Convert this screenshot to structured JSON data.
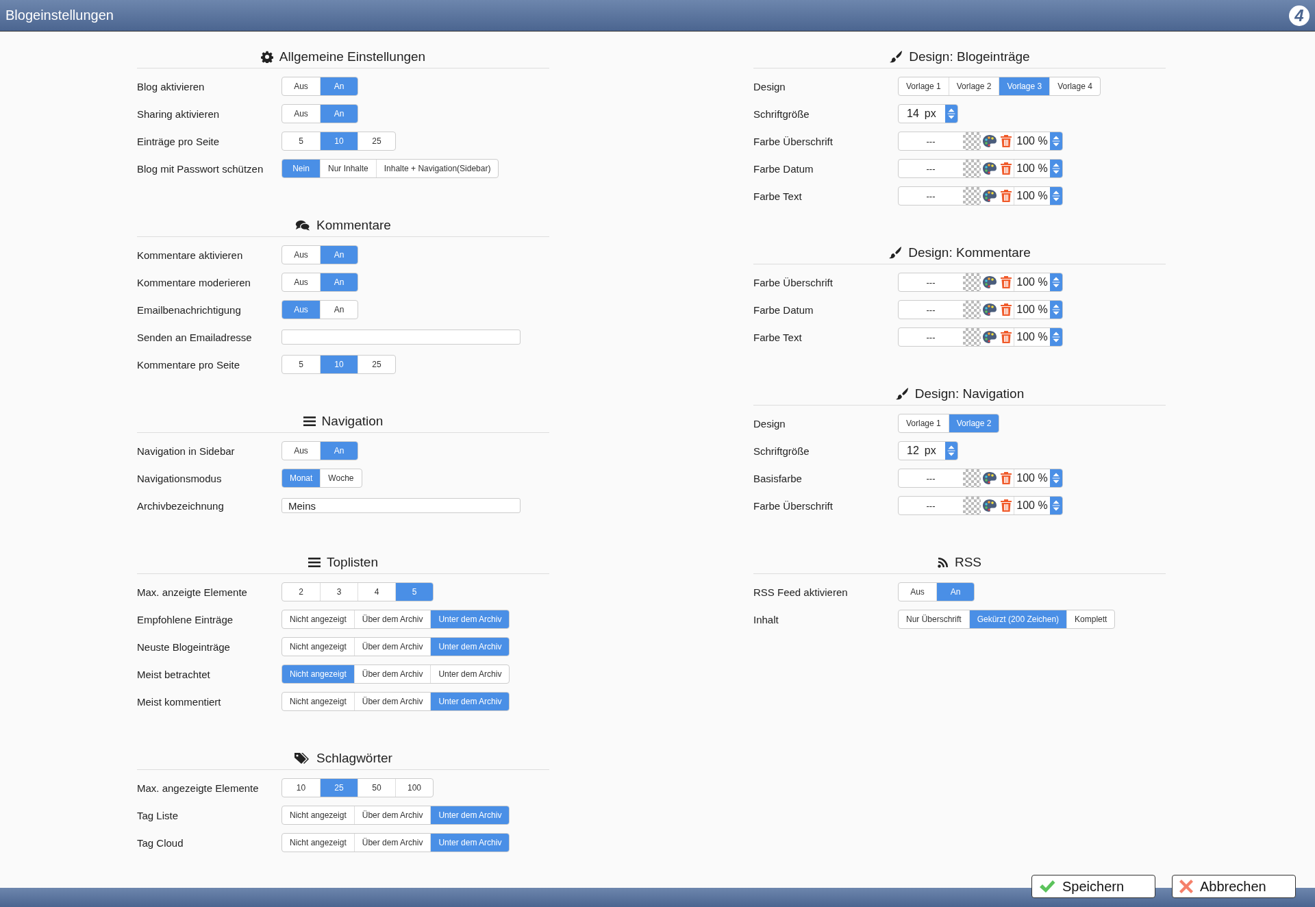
{
  "window": {
    "title": "Blogeinstellungen",
    "logo": "4"
  },
  "columns": [
    {
      "sections": [
        {
          "title": "Allgemeine Einstellungen",
          "rows": [
            {
              "kind": "toggle",
              "label": "Blog aktivieren",
              "options": [
                {
                  "label": "Aus",
                  "selected": false
                },
                {
                  "label": "An",
                  "selected": true
                }
              ]
            },
            {
              "kind": "toggle",
              "label": "Sharing aktivieren",
              "options": [
                {
                  "label": "Aus",
                  "selected": false
                },
                {
                  "label": "An",
                  "selected": true
                }
              ]
            },
            {
              "kind": "toggle",
              "label": "Einträge pro Seite",
              "options": [
                {
                  "label": "5",
                  "selected": false
                },
                {
                  "label": "10",
                  "selected": true
                },
                {
                  "label": "25",
                  "selected": false
                }
              ]
            },
            {
              "kind": "toggle",
              "label": "Blog mit Passwort schützen",
              "options": [
                {
                  "label": "Nein",
                  "selected": true
                },
                {
                  "label": "Nur Inhalte",
                  "selected": false
                },
                {
                  "label": "Inhalte + Navigation(Sidebar)",
                  "selected": false
                }
              ]
            }
          ]
        },
        {
          "title": "Kommentare",
          "rows": [
            {
              "kind": "toggle",
              "label": "Kommentare aktivieren",
              "options": [
                {
                  "label": "Aus",
                  "selected": false
                },
                {
                  "label": "An",
                  "selected": true
                }
              ]
            },
            {
              "kind": "toggle",
              "label": "Kommentare moderieren",
              "options": [
                {
                  "label": "Aus",
                  "selected": false
                },
                {
                  "label": "An",
                  "selected": true
                }
              ]
            },
            {
              "kind": "toggle",
              "label": "Emailbenachrichtigung",
              "options": [
                {
                  "label": "Aus",
                  "selected": true
                },
                {
                  "label": "An",
                  "selected": false
                }
              ]
            },
            {
              "kind": "text",
              "label": "Senden an Emailadresse"
            },
            {
              "kind": "toggle",
              "label": "Kommentare pro Seite",
              "options": [
                {
                  "label": "5",
                  "selected": false
                },
                {
                  "label": "10",
                  "selected": true
                },
                {
                  "label": "25",
                  "selected": false
                }
              ]
            }
          ]
        },
        {
          "title": "Navigation",
          "rows": [
            {
              "kind": "toggle",
              "label": "Navigation in Sidebar",
              "options": [
                {
                  "label": "Aus",
                  "selected": false
                },
                {
                  "label": "An",
                  "selected": true
                }
              ]
            },
            {
              "kind": "toggle",
              "label": "Navigationsmodus",
              "options": [
                {
                  "label": "Monat",
                  "selected": true
                },
                {
                  "label": "Woche",
                  "selected": false
                }
              ]
            },
            {
              "kind": "text",
              "label": "Archivbezeichnung",
              "value": "Meins"
            }
          ]
        },
        {
          "title": "Toplisten",
          "rows": [
            {
              "kind": "toggle",
              "label": "Max. anzeigte Elemente",
              "options": [
                {
                  "label": "2",
                  "selected": false
                },
                {
                  "label": "3",
                  "selected": false
                },
                {
                  "label": "4",
                  "selected": false
                },
                {
                  "label": "5",
                  "selected": true
                }
              ]
            },
            {
              "kind": "toggle",
              "label": "Empfohlene Einträge",
              "options": [
                {
                  "label": "Nicht angezeigt",
                  "selected": false
                },
                {
                  "label": "Über dem Archiv",
                  "selected": false
                },
                {
                  "label": "Unter dem Archiv",
                  "selected": true
                }
              ]
            },
            {
              "kind": "toggle",
              "label": "Neuste Blogeinträge",
              "options": [
                {
                  "label": "Nicht angezeigt",
                  "selected": false
                },
                {
                  "label": "Über dem Archiv",
                  "selected": false
                },
                {
                  "label": "Unter dem Archiv",
                  "selected": true
                }
              ]
            },
            {
              "kind": "toggle",
              "label": "Meist betrachtet",
              "options": [
                {
                  "label": "Nicht angezeigt",
                  "selected": true
                },
                {
                  "label": "Über dem Archiv",
                  "selected": false
                },
                {
                  "label": "Unter dem Archiv",
                  "selected": false
                }
              ]
            },
            {
              "kind": "toggle",
              "label": "Meist kommentiert",
              "options": [
                {
                  "label": "Nicht angezeigt",
                  "selected": false
                },
                {
                  "label": "Über dem Archiv",
                  "selected": false
                },
                {
                  "label": "Unter dem Archiv",
                  "selected": true
                }
              ]
            }
          ]
        },
        {
          "title": "Schlagwörter",
          "rows": [
            {
              "kind": "toggle",
              "label": "Max. angezeigte Elemente",
              "options": [
                {
                  "label": "10",
                  "selected": false
                },
                {
                  "label": "25",
                  "selected": true
                },
                {
                  "label": "50",
                  "selected": false
                },
                {
                  "label": "100",
                  "selected": false
                }
              ]
            },
            {
              "kind": "toggle",
              "label": "Tag Liste",
              "options": [
                {
                  "label": "Nicht angezeigt",
                  "selected": false
                },
                {
                  "label": "Über dem Archiv",
                  "selected": false
                },
                {
                  "label": "Unter dem Archiv",
                  "selected": true
                }
              ]
            },
            {
              "kind": "toggle",
              "label": "Tag Cloud",
              "options": [
                {
                  "label": "Nicht angezeigt",
                  "selected": false
                },
                {
                  "label": "Über dem Archiv",
                  "selected": false
                },
                {
                  "label": "Unter dem Archiv",
                  "selected": true
                }
              ]
            }
          ]
        }
      ]
    },
    {
      "sections": [
        {
          "title": "Design: Blogeinträge",
          "rows": [
            {
              "kind": "toggle",
              "label": "Design",
              "options": [
                {
                  "label": "Vorlage 1",
                  "selected": false
                },
                {
                  "label": "Vorlage 2",
                  "selected": false
                },
                {
                  "label": "Vorlage 3",
                  "selected": true
                },
                {
                  "label": "Vorlage 4",
                  "selected": false
                }
              ]
            },
            {
              "kind": "size",
              "label": "Schriftgröße",
              "value": "14",
              "unit": "px"
            },
            {
              "kind": "color",
              "label": "Farbe Überschrift",
              "value": "---",
              "opacity": "100 %"
            },
            {
              "kind": "color",
              "label": "Farbe Datum",
              "value": "---",
              "opacity": "100 %"
            },
            {
              "kind": "color",
              "label": "Farbe Text",
              "value": "---",
              "opacity": "100 %"
            }
          ]
        },
        {
          "title": "Design: Kommentare",
          "rows": [
            {
              "kind": "color",
              "label": "Farbe Überschrift",
              "value": "---",
              "opacity": "100 %"
            },
            {
              "kind": "color",
              "label": "Farbe Datum",
              "value": "---",
              "opacity": "100 %"
            },
            {
              "kind": "color",
              "label": "Farbe Text",
              "value": "---",
              "opacity": "100 %"
            }
          ]
        },
        {
          "title": "Design: Navigation",
          "rows": [
            {
              "kind": "toggle",
              "label": "Design",
              "options": [
                {
                  "label": "Vorlage 1",
                  "selected": false
                },
                {
                  "label": "Vorlage 2",
                  "selected": true
                }
              ]
            },
            {
              "kind": "size",
              "label": "Schriftgröße",
              "value": "12",
              "unit": "px"
            },
            {
              "kind": "color",
              "label": "Basisfarbe",
              "value": "---",
              "opacity": "100 %"
            },
            {
              "kind": "color",
              "label": "Farbe Überschrift",
              "value": "---",
              "opacity": "100 %"
            }
          ]
        },
        {
          "title": "RSS",
          "rows": [
            {
              "kind": "toggle",
              "label": "RSS Feed aktivieren",
              "options": [
                {
                  "label": "Aus",
                  "selected": false
                },
                {
                  "label": "An",
                  "selected": true
                }
              ]
            },
            {
              "kind": "toggle",
              "label": "Inhalt",
              "options": [
                {
                  "label": "Nur Überschrift",
                  "selected": false
                },
                {
                  "label": "Gekürzt (200 Zeichen)",
                  "selected": true
                },
                {
                  "label": "Komplett",
                  "selected": false
                }
              ]
            }
          ]
        }
      ]
    }
  ],
  "buttons": [
    {
      "kind": "save",
      "label": "Speichern"
    },
    {
      "kind": "cancel",
      "label": "Abbrechen"
    }
  ]
}
